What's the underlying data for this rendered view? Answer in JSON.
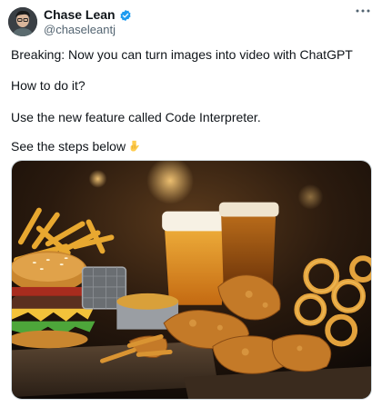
{
  "author": {
    "name": "Chase Lean",
    "handle": "@chaseleantj",
    "verified": true,
    "avatar_icon": "avatar-photo"
  },
  "tweet": {
    "lines": [
      "Breaking: Now you can turn images into video with ChatGPT",
      "How to do it?",
      "Use the new feature called Code Interpreter.",
      "See the steps below"
    ],
    "emoji_icon": "pointing-down-hand-emoji"
  },
  "colors": {
    "verified": "#1d9bf0",
    "handle": "#536471",
    "text": "#0f1419"
  },
  "media": {
    "icon": "food-photo"
  }
}
